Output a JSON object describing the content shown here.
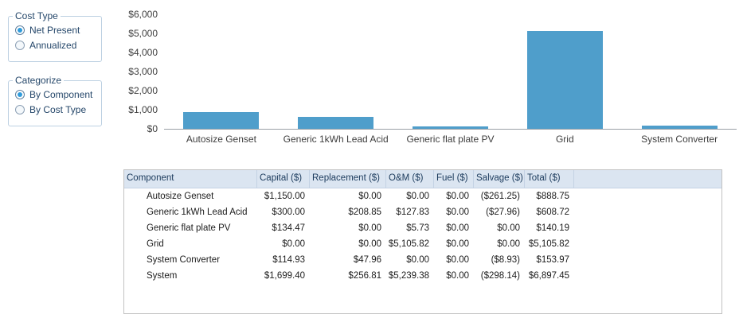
{
  "panels": {
    "cost_type": {
      "title": "Cost Type",
      "options": [
        {
          "label": "Net Present",
          "selected": true
        },
        {
          "label": "Annualized",
          "selected": false
        }
      ]
    },
    "categorize": {
      "title": "Categorize",
      "options": [
        {
          "label": "By Component",
          "selected": true
        },
        {
          "label": "By Cost Type",
          "selected": false
        }
      ]
    }
  },
  "chart_data": {
    "type": "bar",
    "title": "",
    "xlabel": "",
    "ylabel": "",
    "categories": [
      "Autosize Genset",
      "Generic 1kWh Lead Acid",
      "Generic flat plate PV",
      "Grid",
      "System Converter"
    ],
    "values": [
      888.75,
      608.72,
      140.19,
      5105.82,
      153.97
    ],
    "ylim": [
      0,
      6000
    ],
    "ytick_interval": 1000,
    "ytick_labels": [
      "$0",
      "$1,000",
      "$2,000",
      "$3,000",
      "$4,000",
      "$5,000",
      "$6,000"
    ],
    "grid": false,
    "legend": false,
    "bar_color": "#4f9ecb"
  },
  "table": {
    "columns": [
      "Component",
      "Capital ($)",
      "Replacement ($)",
      "O&M ($)",
      "Fuel ($)",
      "Salvage ($)",
      "Total ($)"
    ],
    "rows": [
      [
        "Autosize Genset",
        "$1,150.00",
        "$0.00",
        "$0.00",
        "$0.00",
        "($261.25)",
        "$888.75"
      ],
      [
        "Generic 1kWh Lead Acid",
        "$300.00",
        "$208.85",
        "$127.83",
        "$0.00",
        "($27.96)",
        "$608.72"
      ],
      [
        "Generic flat plate PV",
        "$134.47",
        "$0.00",
        "$5.73",
        "$0.00",
        "$0.00",
        "$140.19"
      ],
      [
        "Grid",
        "$0.00",
        "$0.00",
        "$5,105.82",
        "$0.00",
        "$0.00",
        "$5,105.82"
      ],
      [
        "System Converter",
        "$114.93",
        "$47.96",
        "$0.00",
        "$0.00",
        "($8.93)",
        "$153.97"
      ],
      [
        "System",
        "$1,699.40",
        "$256.81",
        "$5,239.38",
        "$0.00",
        "($298.14)",
        "$6,897.45"
      ]
    ]
  },
  "colors": {
    "bar": "#4f9ecb",
    "table_header_bg": "#dbe5f1",
    "table_header_text": "#1b3a5c",
    "groupbox_border": "#bcd0e2",
    "radio_selected_dot": "#2f9bdb",
    "axis_line": "#9aa0a6"
  }
}
